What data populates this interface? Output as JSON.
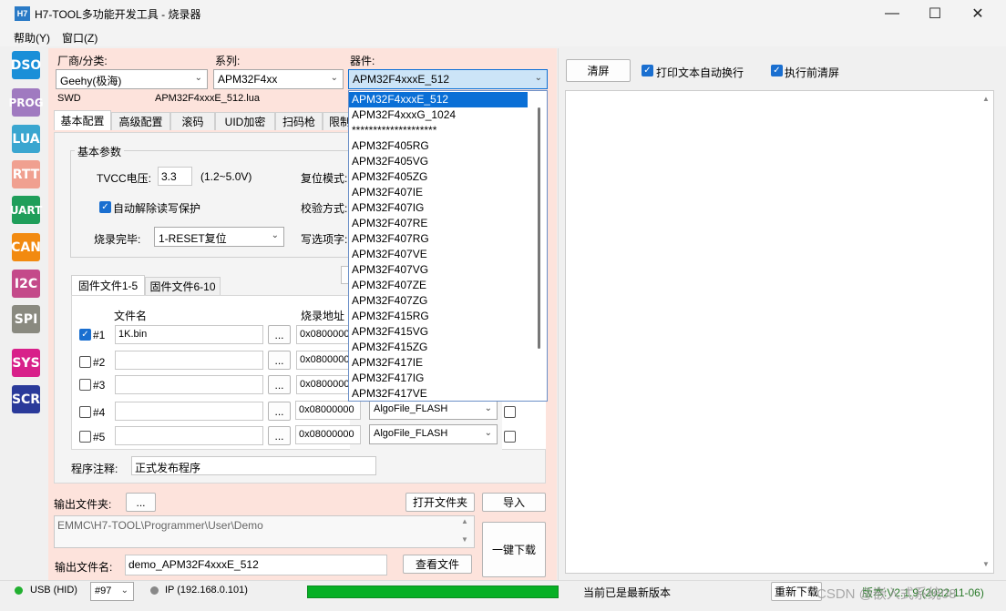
{
  "window": {
    "title": "H7-TOOL多功能开发工具 - 烧录器",
    "app_icon": "H7"
  },
  "window_controls": {
    "minimize": "—",
    "maximize": "☐",
    "close": "✕"
  },
  "menu": [
    "帮助(Y)",
    "窗口(Z)"
  ],
  "sidebar": [
    {
      "label": "DSO",
      "color": "#1a8fd8"
    },
    {
      "label": "PROG",
      "color": "#a07ac0"
    },
    {
      "label": "LUA",
      "color": "#3aa6d0"
    },
    {
      "label": "RTT",
      "color": "#f0a090"
    },
    {
      "label": "UART",
      "color": "#1f9e5a"
    },
    {
      "label": "CAN",
      "color": "#f28a10"
    },
    {
      "label": "I2C",
      "color": "#c44a8a"
    },
    {
      "label": "SPI",
      "color": "#8a8a80"
    },
    {
      "label": "SYS",
      "color": "#d8208a"
    },
    {
      "label": "SCR",
      "color": "#2a3a9a"
    }
  ],
  "selectors": {
    "vendor_label": "厂商/分类:",
    "vendor_value": "Geehy(极海)",
    "series_label": "系列:",
    "series_value": "APM32F4xx",
    "device_label": "器件:",
    "device_value": "APM32F4xxxE_512",
    "interface": "SWD",
    "lua_file": "APM32F4xxxE_512.lua"
  },
  "tabs": [
    "基本配置",
    "高级配置",
    "滚码",
    "UID加密",
    "扫码枪",
    "限制"
  ],
  "basic": {
    "group_title": "基本参数",
    "tvcc_label": "TVCC电压:",
    "tvcc_value": "3.3",
    "tvcc_range": "(1.2~5.0V)",
    "reset_mode_label": "复位模式:",
    "auto_unlock_label": "自动解除读写保护",
    "verify_label": "校验方式:",
    "finish_label": "烧录完毕:",
    "finish_value": "1-RESET复位",
    "option_label": "写选项字:"
  },
  "firmware_tabs": [
    "固件文件1-5",
    "固件文件6-10"
  ],
  "firmware_headers": {
    "file": "文件名",
    "addr": "烧录地址"
  },
  "firmware_rows": [
    {
      "num": "#1",
      "checked": true,
      "file": "1K.bin",
      "browse": "...",
      "addr": "0x08000000",
      "algo": "",
      "show_algo": false
    },
    {
      "num": "#2",
      "checked": false,
      "file": "",
      "browse": "...",
      "addr": "0x08000000",
      "algo": "",
      "show_algo": false
    },
    {
      "num": "#3",
      "checked": false,
      "file": "",
      "browse": "...",
      "addr": "0x08000000",
      "algo": "",
      "show_algo": false
    },
    {
      "num": "#4",
      "checked": false,
      "file": "",
      "browse": "...",
      "addr": "0x08000000",
      "algo": "AlgoFile_FLASH",
      "show_algo": true
    },
    {
      "num": "#5",
      "checked": false,
      "file": "",
      "browse": "...",
      "addr": "0x08000000",
      "algo": "AlgoFile_FLASH",
      "show_algo": true
    }
  ],
  "comment": {
    "label": "程序注释:",
    "value": "正式发布程序"
  },
  "output": {
    "folder_label": "输出文件夹:",
    "folder_browse": "...",
    "open_folder": "打开文件夹",
    "import": "导入",
    "path": "EMMC\\H7-TOOL\\Programmer\\User\\Demo",
    "name_label": "输出文件名:",
    "name_value": "demo_APM32F4xxxE_512",
    "view_file": "查看文件",
    "one_click": "一键下载"
  },
  "device_list": [
    "APM32F4xxxE_512",
    "APM32F4xxxG_1024",
    "********************",
    "APM32F405RG",
    "APM32F405VG",
    "APM32F405ZG",
    "APM32F407IE",
    "APM32F407IG",
    "APM32F407RE",
    "APM32F407RG",
    "APM32F407VE",
    "APM32F407VG",
    "APM32F407ZE",
    "APM32F407ZG",
    "APM32F415RG",
    "APM32F415VG",
    "APM32F415ZG",
    "APM32F417IE",
    "APM32F417IG",
    "APM32F417VE"
  ],
  "right": {
    "clear": "清屏",
    "wrap_label": "打印文本自动换行",
    "clear_before_label": "执行前清屏"
  },
  "status": {
    "usb": "USB (HID)",
    "device_num": "#97",
    "ip": "IP (192.168.0.101)",
    "progress": 1.0,
    "message": "当前已是最新版本",
    "update": "重新下载",
    "version": "版本:V2.1.9 (2022-11-06)",
    "watermark": "CSDN @嵌入式系统08"
  }
}
